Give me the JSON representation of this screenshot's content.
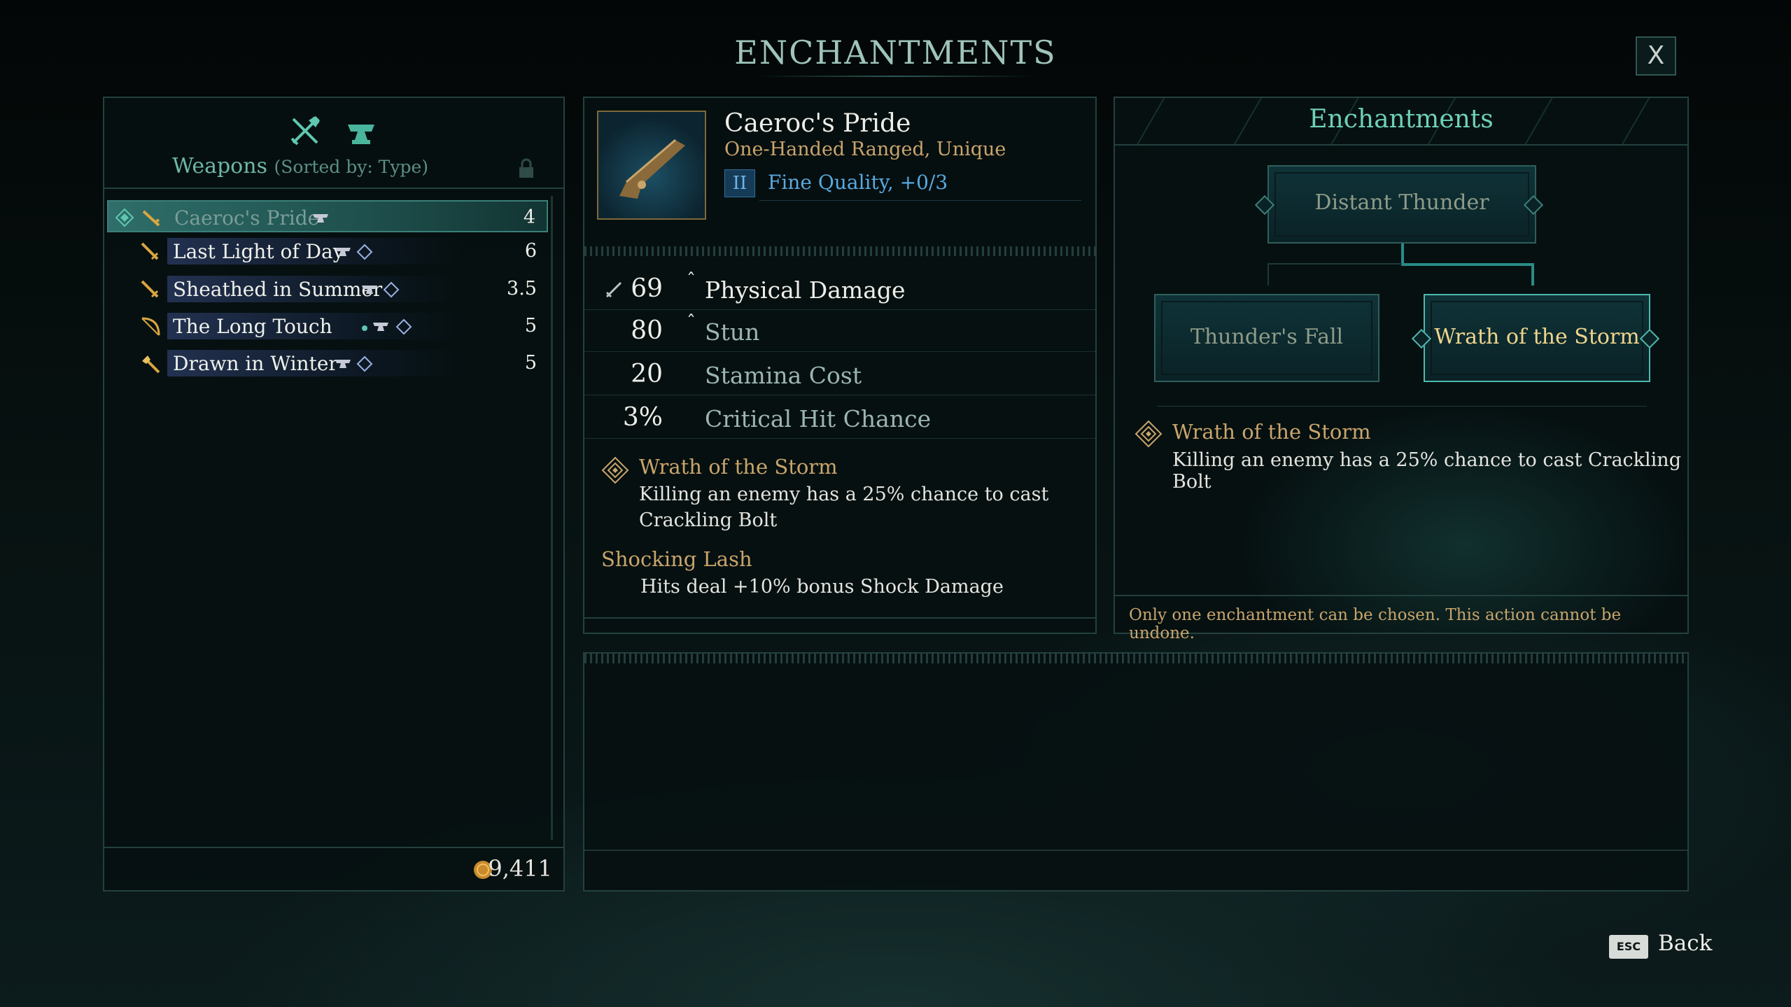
{
  "screen": {
    "title": "ENCHANTMENTS",
    "close_label": "X",
    "back_key": "ESC",
    "back_label": "Back"
  },
  "inventory": {
    "filter_icons": [
      "crossed-weapons-icon",
      "anvil-icon"
    ],
    "list_title": "Weapons",
    "list_sort": "(Sorted by: Type)",
    "items": [
      {
        "name": "Caeroc's Pride",
        "value": "4",
        "icon": "firearm-icon",
        "selected": true
      },
      {
        "name": "Last Light of Day",
        "value": "6",
        "icon": "sword-icon",
        "selected": false
      },
      {
        "name": "Sheathed in Summer",
        "value": "3.5",
        "icon": "sword-icon",
        "selected": false
      },
      {
        "name": "The Long Touch",
        "value": "5",
        "icon": "bow-icon",
        "selected": false
      },
      {
        "name": "Drawn in Winter",
        "value": "5",
        "icon": "axe-icon",
        "selected": false
      }
    ],
    "currency": "9,411"
  },
  "item": {
    "name": "Caeroc's Pride",
    "type": "One-Handed Ranged, Unique",
    "quality_tier": "II",
    "quality": "Fine Quality, +0/3",
    "stats": [
      {
        "value": "69",
        "label": "Physical Damage",
        "caret": "ˆ"
      },
      {
        "value": "80",
        "label": "Stun",
        "caret": "ˆ"
      },
      {
        "value": "20",
        "label": "Stamina Cost",
        "caret": ""
      },
      {
        "value": "3%",
        "label": "Critical Hit Chance",
        "caret": ""
      }
    ],
    "enchantments": [
      {
        "title": "Wrath of the Storm",
        "desc": "Killing an enemy has a 25% chance to cast Crackling Bolt"
      },
      {
        "title": "Shocking Lash",
        "desc": "Hits deal +10% bonus Shock Damage"
      }
    ]
  },
  "enchant_tree": {
    "title": "Enchantments",
    "root": "Distant Thunder",
    "left": "Thunder's Fall",
    "right": "Wrath of the Storm",
    "detail_title": "Wrath of the Storm",
    "detail_desc": "Killing an enemy has a 25% chance to cast Crackling Bolt",
    "footer": "Only one enchantment can be chosen. This action cannot be undone."
  },
  "colors": {
    "accent_teal": "#5fc7b0",
    "gold_text": "#c9a56b",
    "quality_blue": "#58a9df"
  }
}
